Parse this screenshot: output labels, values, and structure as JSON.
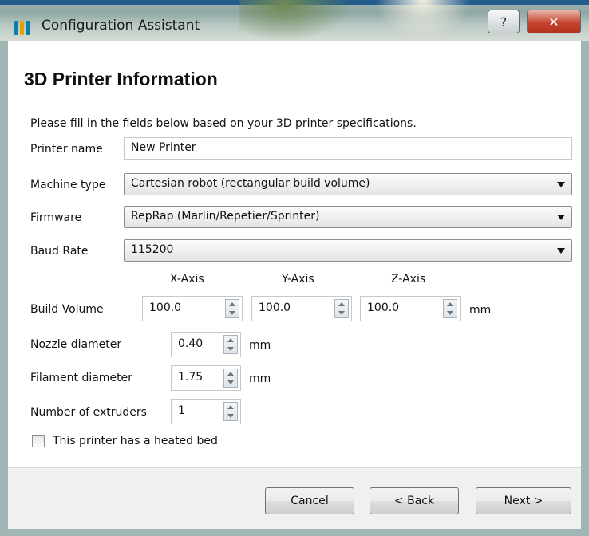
{
  "window": {
    "title": "Configuration Assistant",
    "help_glyph": "?",
    "close_glyph": "✕",
    "app_icon": "bars-app-icon"
  },
  "page": {
    "title": "3D Printer Information",
    "intro": "Please fill in the fields below based on your 3D printer specifications."
  },
  "form": {
    "printer_name_label": "Printer name",
    "printer_name_value": "New Printer",
    "machine_type_label": "Machine type",
    "machine_type_value": "Cartesian robot (rectangular build volume)",
    "firmware_label": "Firmware",
    "firmware_value": "RepRap (Marlin/Repetier/Sprinter)",
    "baud_rate_label": "Baud Rate",
    "baud_rate_value": "115200",
    "axis_headers": [
      "X-Axis",
      "Y-Axis",
      "Z-Axis"
    ],
    "build_volume_label": "Build Volume",
    "build_volume": [
      "100.0",
      "100.0",
      "100.0"
    ],
    "unit_mm": "mm",
    "nozzle_label": "Nozzle diameter",
    "nozzle_value": "0.40",
    "filament_label": "Filament diameter",
    "filament_value": "1.75",
    "extruders_label": "Number of extruders",
    "extruders_value": "1",
    "heated_bed_label": "This printer has a heated bed",
    "heated_bed_checked": false
  },
  "buttons": {
    "cancel": "Cancel",
    "back": "< Back",
    "next": "Next >"
  },
  "colors": {
    "titlebar": "#8fa7a5",
    "close_button": "#c6452f",
    "footer": "#f0f0f0"
  }
}
